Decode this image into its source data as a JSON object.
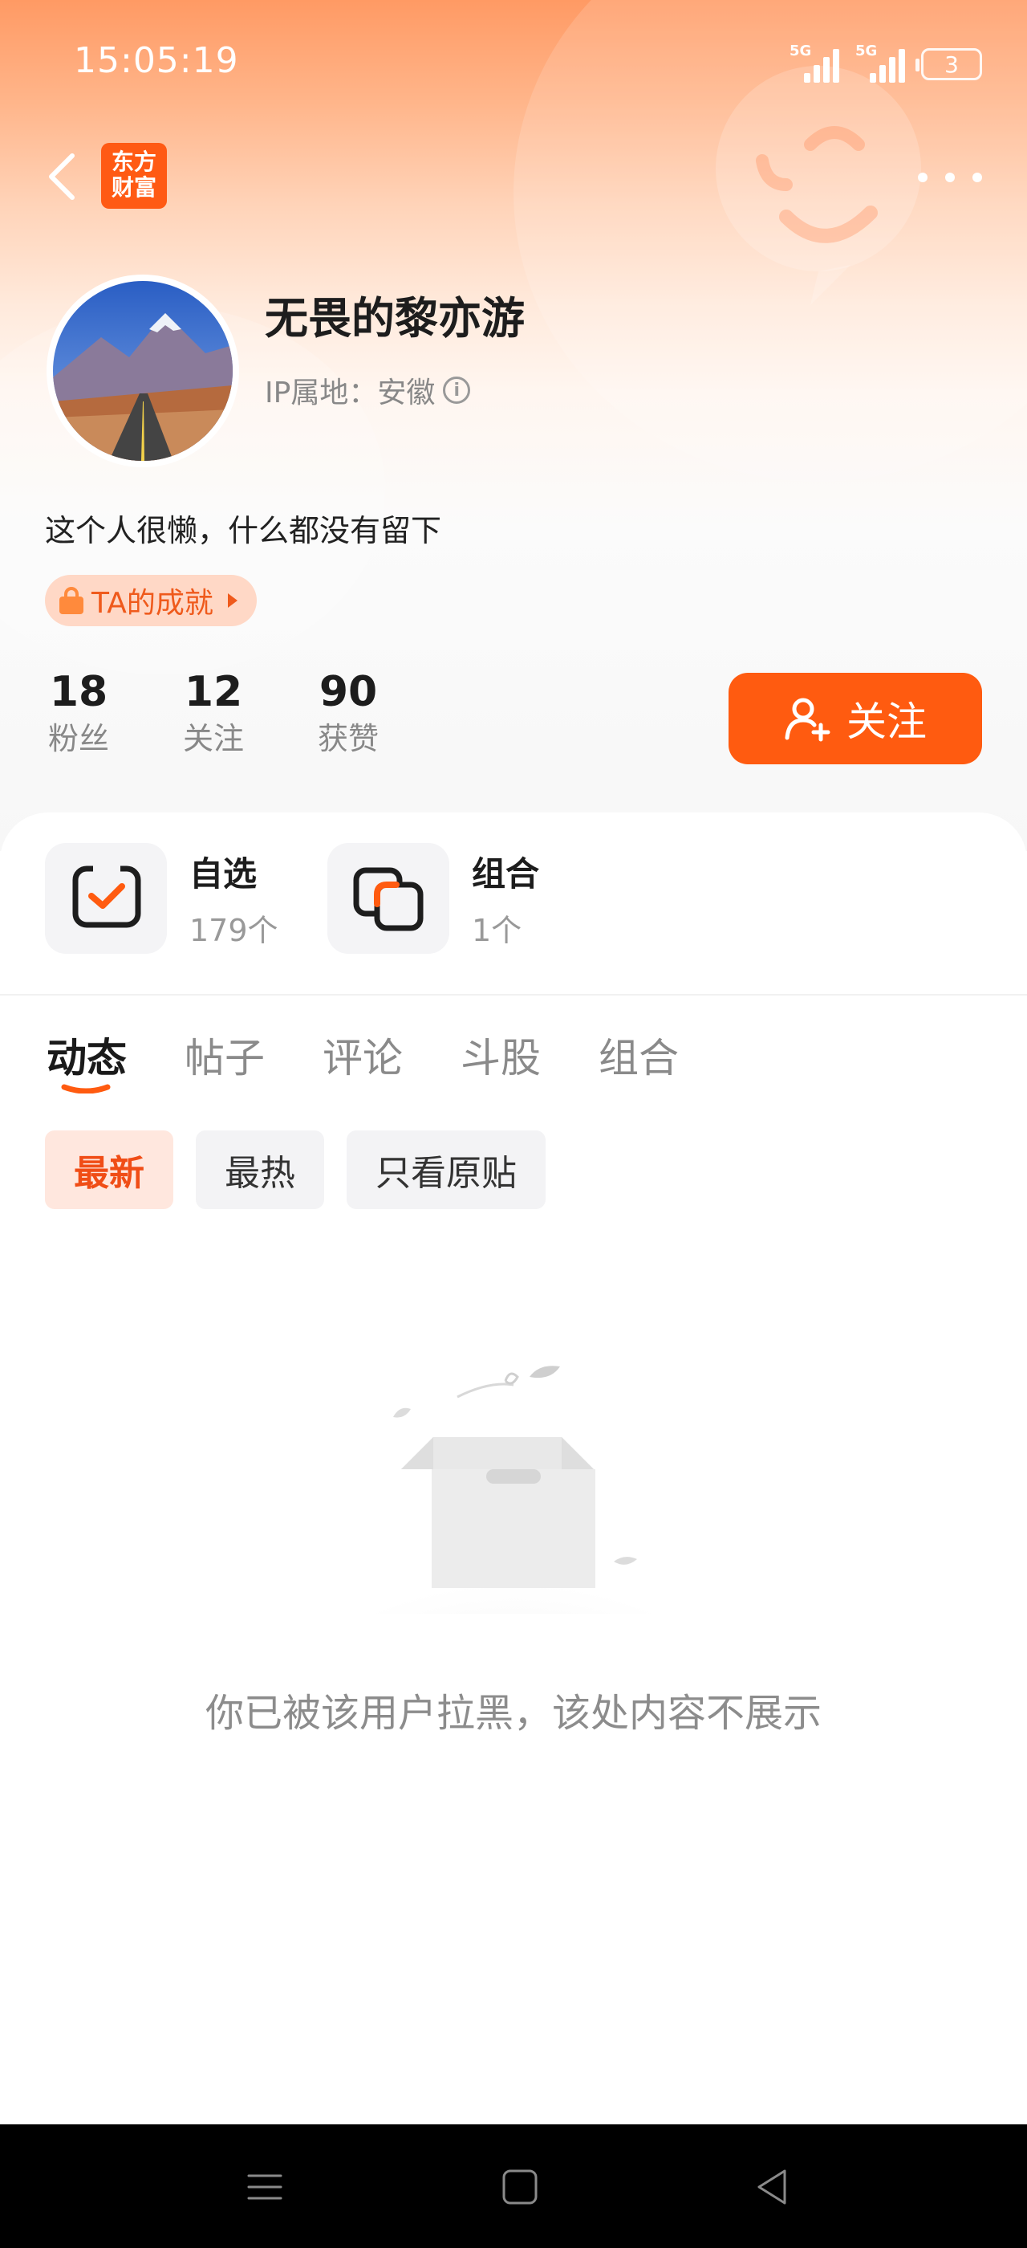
{
  "status_bar": {
    "time": "15:05:19",
    "signal_1_label": "5G",
    "signal_2_label": "5G",
    "battery": "3"
  },
  "header": {
    "logo_text_line1": "东方",
    "logo_text_line2": "财富"
  },
  "profile": {
    "username": "无畏的黎亦游",
    "ip_location": "IP属地：安徽",
    "bio": "这个人很懒，什么都没有留下",
    "achievement_label": "TA的成就"
  },
  "stats": [
    {
      "value": "18",
      "label": "粉丝"
    },
    {
      "value": "12",
      "label": "关注"
    },
    {
      "value": "90",
      "label": "获赞"
    }
  ],
  "follow_button": {
    "label": "关注"
  },
  "quick_links": [
    {
      "title": "自选",
      "count": "179个"
    },
    {
      "title": "组合",
      "count": "1个"
    }
  ],
  "tabs": [
    "动态",
    "帖子",
    "评论",
    "斗股",
    "组合"
  ],
  "active_tab": "动态",
  "filters": [
    "最新",
    "最热",
    "只看原贴"
  ],
  "active_filter": "最新",
  "empty_state": {
    "message": "你已被该用户拉黑，该处内容不展示"
  },
  "colors": {
    "accent": "#ff5b10",
    "accent_text": "#f04d16",
    "chip_active_bg": "#ffe7de"
  }
}
